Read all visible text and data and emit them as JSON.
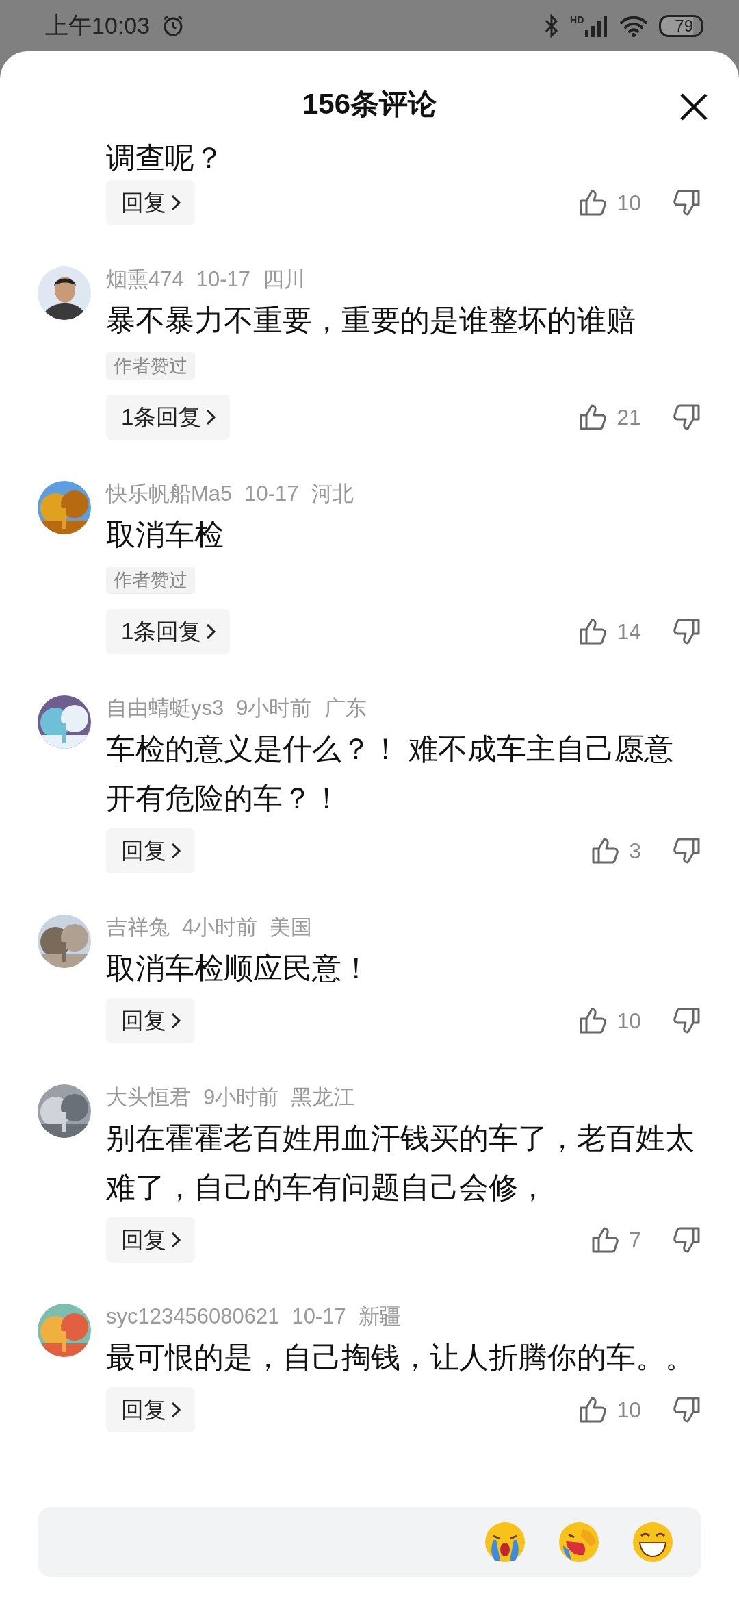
{
  "status_bar": {
    "time": "上午10:03",
    "network": "HD",
    "battery": "79"
  },
  "header": {
    "title": "156条评论"
  },
  "comments": [
    {
      "content": "调查呢？",
      "reply": "回复",
      "likes": "10"
    },
    {
      "author": "烟熏474",
      "date": "10-17",
      "location": "四川",
      "content": "暴不暴力不重要，重要的是谁整坏的谁赔",
      "badge": "作者赞过",
      "reply": "1条回复",
      "likes": "21"
    },
    {
      "author": "快乐帆船Ma5",
      "date": "10-17",
      "location": "河北",
      "content": "取消车检",
      "badge": "作者赞过",
      "reply": "1条回复",
      "likes": "14"
    },
    {
      "author": "自由蜻蜓ys3",
      "date": "9小时前",
      "location": "广东",
      "content": "车检的意义是什么？！ 难不成车主自己愿意开有危险的车？！",
      "reply": "回复",
      "likes": "3"
    },
    {
      "author": "吉祥兔",
      "date": "4小时前",
      "location": "美国",
      "content": "取消车检顺应民意！",
      "reply": "回复",
      "likes": "10"
    },
    {
      "author": "大头恒君",
      "date": "9小时前",
      "location": "黑龙江",
      "content": "别在霍霍老百姓用血汗钱买的车了，老百姓太难了，自己的车有问题自己会修，",
      "reply": "回复",
      "likes": "7"
    },
    {
      "author": "syc123456080621",
      "date": "10-17",
      "location": "新疆",
      "content": "最可恨的是，自己掏钱，让人折腾你的车。。",
      "reply": "回复",
      "likes": "10"
    }
  ]
}
